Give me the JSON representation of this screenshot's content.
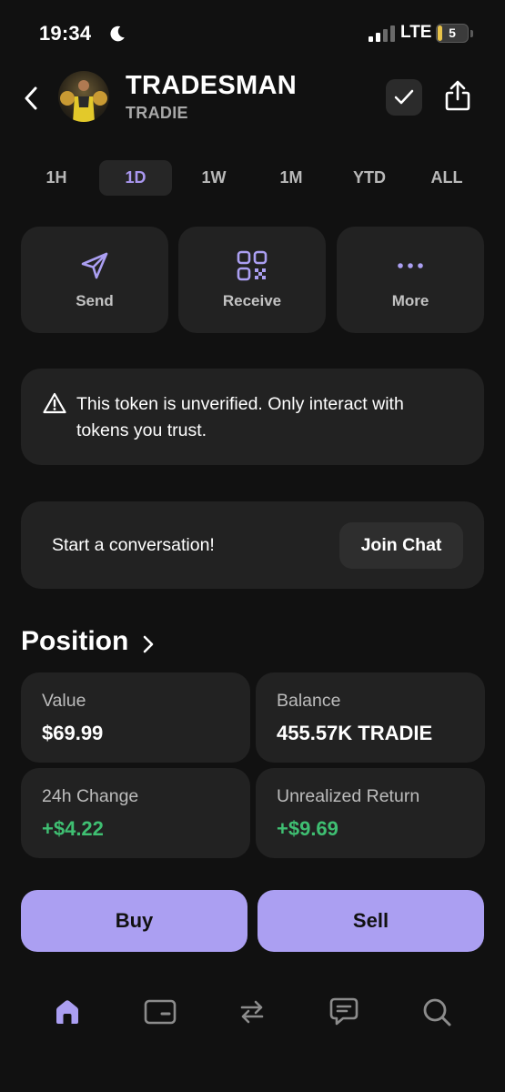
{
  "status": {
    "time": "19:34",
    "network": "LTE",
    "battery_level": "5",
    "battery_fraction": 0.05
  },
  "header": {
    "token_name": "TRADESMAN",
    "token_symbol": "TRADIE"
  },
  "timeframes": [
    {
      "label": "1H",
      "active": false
    },
    {
      "label": "1D",
      "active": true
    },
    {
      "label": "1W",
      "active": false
    },
    {
      "label": "1M",
      "active": false
    },
    {
      "label": "YTD",
      "active": false
    },
    {
      "label": "ALL",
      "active": false
    }
  ],
  "actions": [
    {
      "label": "Send",
      "icon": "send-icon"
    },
    {
      "label": "Receive",
      "icon": "qr-code-icon"
    },
    {
      "label": "More",
      "icon": "more-dots-icon"
    }
  ],
  "warning": {
    "text": "This token is unverified. Only interact with tokens you trust.",
    "icon": "warning-triangle-icon"
  },
  "chat": {
    "text": "Start a conversation!",
    "button_label": "Join Chat"
  },
  "position": {
    "title": "Position",
    "stats": [
      {
        "key": "Value",
        "value": "$69.99",
        "positive": false
      },
      {
        "key": "Balance",
        "value": "455.57K TRADIE",
        "positive": false
      },
      {
        "key": "24h Change",
        "value": "+$4.22",
        "positive": true
      },
      {
        "key": "Unrealized Return",
        "value": "+$9.69",
        "positive": true
      }
    ]
  },
  "trade": {
    "buy_label": "Buy",
    "sell_label": "Sell"
  },
  "tabbar": [
    {
      "icon": "home-icon",
      "active": true
    },
    {
      "icon": "wallet-card-icon",
      "active": false
    },
    {
      "icon": "swap-arrows-icon",
      "active": false
    },
    {
      "icon": "chat-bubble-icon",
      "active": false
    },
    {
      "icon": "search-icon",
      "active": false
    }
  ],
  "colors": {
    "accent": "#ab9ff2",
    "accent_text": "#a997ef",
    "positive": "#3fbf72",
    "background": "#111111",
    "card": "#222222"
  }
}
